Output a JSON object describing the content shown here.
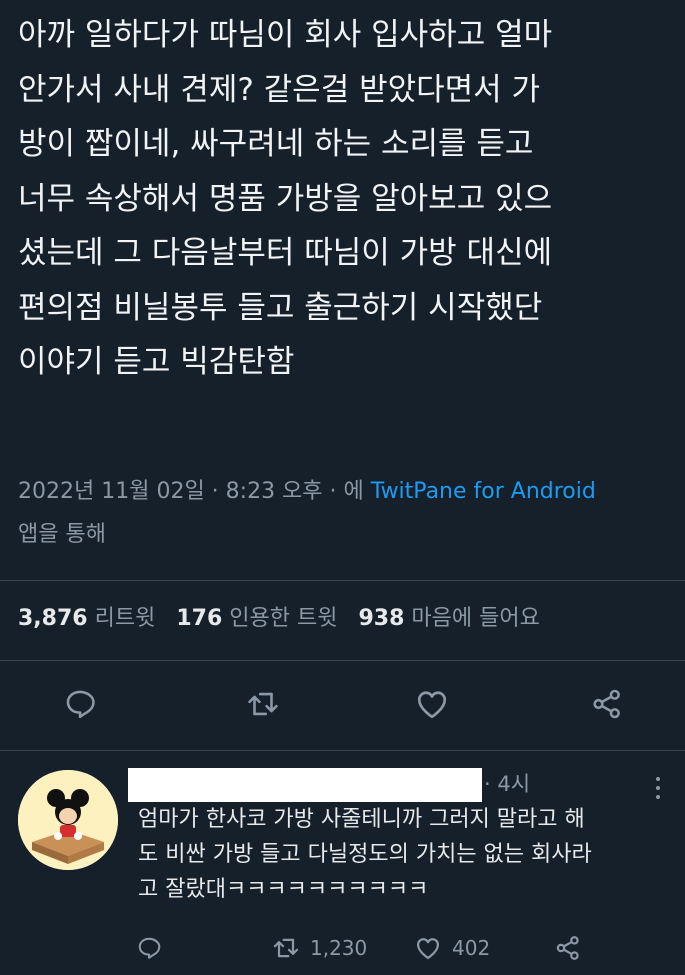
{
  "tweet": {
    "lines": [
      "아까 일하다가 따님이 회사 입사하고 얼마",
      "안가서 사내 견제? 같은걸 받았다면서 가",
      "방이 짭이네, 싸구려네 하는 소리를 듣고",
      "너무 속상해서 명품 가방을 알아보고 있으",
      "셨는데 그 다음날부터 따님이 가방 대신에",
      "편의점 비닐봉투 들고 출근하기 시작했단",
      "이야기 듣고 빅감탄함"
    ]
  },
  "meta": {
    "timestamp": "2022년 11월 02일 · 8:23 오후 · 에",
    "source": "TwitPane for Android",
    "suffix": "앱을 통해"
  },
  "stats": {
    "retweets_count": "3,876",
    "retweets_label": "리트윗",
    "quotes_count": "176",
    "quotes_label": "인용한 트윗",
    "likes_count": "938",
    "likes_label": "마음에 들어요"
  },
  "icons": {
    "reply": "reply-icon",
    "retweet": "retweet-icon",
    "like": "heart-icon",
    "share": "share-icon",
    "more": "more-icon"
  },
  "colors": {
    "background": "#15202b",
    "link": "#1d9bf0",
    "muted": "#8b98a5"
  },
  "reply": {
    "time": "· 4시",
    "lines": [
      "엄마가 한사코 가방 사줄테니까 그러지 말라고 해",
      "도 비싼 가방 들고 다닐정도의 가치는 없는 회사라",
      "고 잘랐대ㅋㅋㅋㅋㅋㅋㅋㅋㅋㅋ"
    ],
    "retweet_count": "1,230",
    "like_count": "402"
  }
}
